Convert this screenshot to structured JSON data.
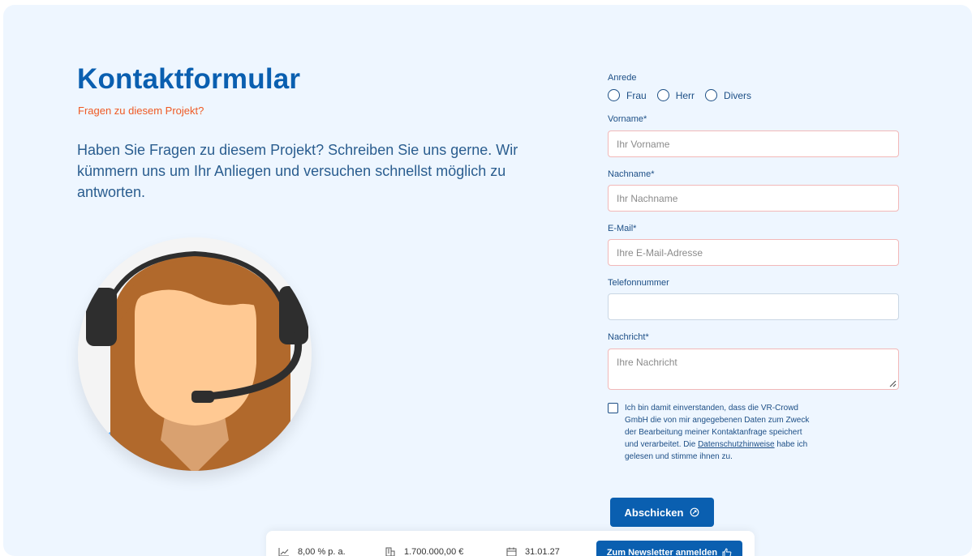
{
  "header": {
    "title": "Kontaktformular",
    "subtitle": "Fragen zu diesem Projekt?",
    "intro": "Haben Sie Fragen zu diesem Projekt? Schreiben Sie uns gerne. Wir kümmern uns um Ihr Anliegen und versuchen schnellst möglich zu antworten."
  },
  "form": {
    "salutation": {
      "label": "Anrede",
      "options": [
        "Frau",
        "Herr",
        "Divers"
      ]
    },
    "first_name": {
      "label": "Vorname*",
      "placeholder": "Ihr Vorname"
    },
    "last_name": {
      "label": "Nachname*",
      "placeholder": "Ihr Nachname"
    },
    "email": {
      "label": "E-Mail*",
      "placeholder": "Ihre E-Mail-Adresse"
    },
    "phone": {
      "label": "Telefonnummer",
      "placeholder": ""
    },
    "message": {
      "label": "Nachricht*",
      "placeholder": "Ihre Nachricht"
    },
    "consent": {
      "text_before": "Ich bin damit einverstanden, dass die VR-Crowd GmbH die von mir angegebenen Daten zum Zweck der Bearbeitung meiner Kontaktanfrage speichert und verarbeitet. Die ",
      "link": "Datenschutzhinweise",
      "text_after": " habe ich gelesen und stimme ihnen zu."
    },
    "submit_label": "Abschicken"
  },
  "bottom_bar": {
    "interest": "8,00 % p. a.",
    "volume": "1.700.000,00 €",
    "date": "31.01.27",
    "newsletter_label": "Zum Newsletter anmelden"
  },
  "colors": {
    "brand_blue": "#0a5fb0",
    "accent_orange": "#ef5a24",
    "background": "#eef6ff"
  }
}
